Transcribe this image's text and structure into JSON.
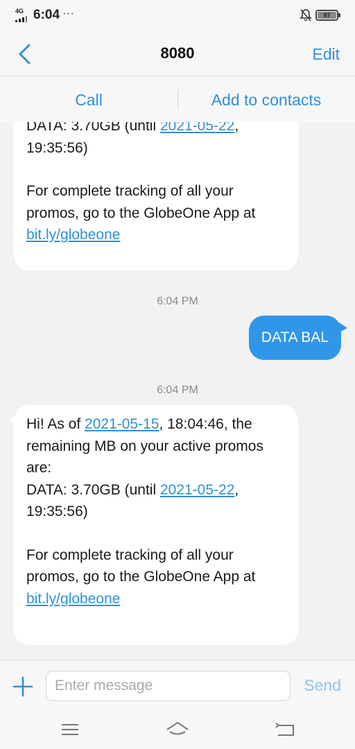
{
  "status_bar": {
    "network": "4G",
    "time": "6:04",
    "more": "···",
    "battery_level": "97",
    "icons": [
      "signal-icon",
      "mute-bell-icon",
      "battery-icon"
    ]
  },
  "header": {
    "title": "8080",
    "edit_label": "Edit"
  },
  "actions": {
    "call_label": "Call",
    "add_contact_label": "Add to contacts"
  },
  "messages": {
    "first_partial": {
      "line1_prefix": "DATA: 3.70GB (until ",
      "line1_link": "2021-05-22",
      "line1_suffix": ",",
      "line2": "19:35:56)",
      "line3": "For complete tracking of all your",
      "line4": "promos, go to the GlobeOne App at",
      "link": "bit.ly/globeone"
    },
    "time_1": "6:04 PM",
    "sent_text": "DATA BAL",
    "time_2": "6:04 PM",
    "received": {
      "l1_prefix": "Hi! As of ",
      "l1_link": "2021-05-15",
      "l1_suffix": ", 18:04:46, the",
      "l2": "remaining MB on your active promos",
      "l3": "are:",
      "l4_prefix": "DATA: 3.70GB (until ",
      "l4_link": "2021-05-22",
      "l4_suffix": ",",
      "l5": "19:35:56)",
      "l6": "For complete tracking of all your",
      "l7": "promos, go to the GlobeOne App at",
      "link": "bit.ly/globeone"
    }
  },
  "composer": {
    "placeholder": "Enter message",
    "send_label": "Send"
  },
  "colors": {
    "accent": "#2f8fd8",
    "sent_bubble": "#2f96ea",
    "received_bubble": "#ffffff",
    "background": "#f2f2f2"
  }
}
